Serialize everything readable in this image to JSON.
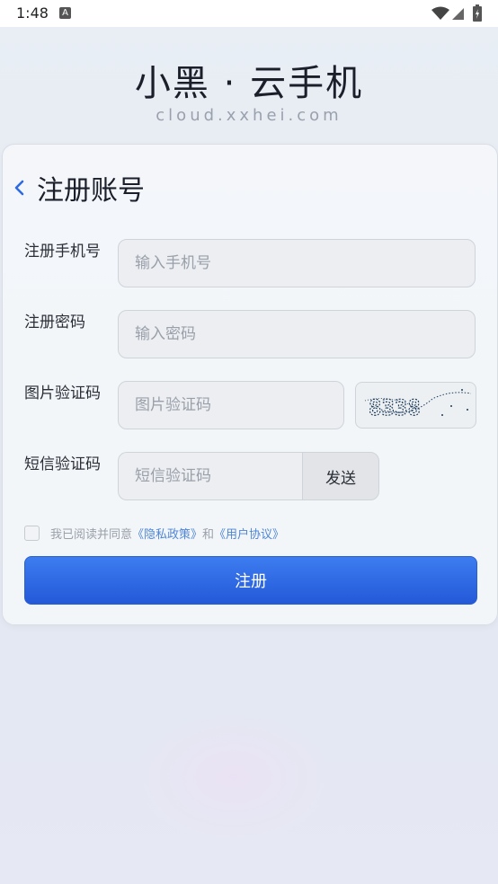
{
  "status_bar": {
    "time": "1:48",
    "notification_letter": "A"
  },
  "brand": {
    "title": "小黑 · 云手机",
    "subtitle": "cloud.xxhei.com"
  },
  "page": {
    "title": "注册账号"
  },
  "form": {
    "phone": {
      "label": "注册手机号",
      "placeholder": "输入手机号",
      "value": ""
    },
    "password": {
      "label": "注册密码",
      "placeholder": "输入密码",
      "value": ""
    },
    "captcha": {
      "label": "图片验证码",
      "placeholder": "图片验证码",
      "value": "",
      "image_text": "8338"
    },
    "sms": {
      "label": "短信验证码",
      "placeholder": "短信验证码",
      "value": "",
      "send_label": "发送"
    },
    "agree": {
      "prefix": "我已阅读并同意",
      "privacy_link": "《隐私政策》",
      "and": "和",
      "user_link": "《用户协议》",
      "checked": false
    },
    "submit_label": "注册"
  },
  "colors": {
    "accent": "#2f6be0",
    "link": "#4f86d6",
    "back_arrow": "#2f6be0"
  }
}
